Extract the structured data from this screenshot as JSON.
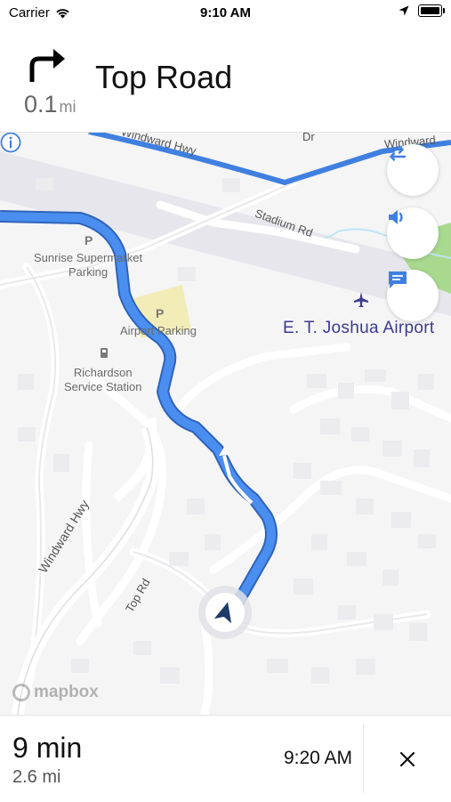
{
  "status_bar": {
    "carrier": "Carrier",
    "time": "9:10 AM"
  },
  "banner": {
    "distance_value": "0.1",
    "distance_unit": "mi",
    "street_name": "Top Road",
    "maneuver_icon": "turn-right-icon"
  },
  "map": {
    "labels": {
      "windward_hwy_top": "Windward Hwy",
      "windward_top_right": "Windward",
      "stadium_rd": "Stadium Rd",
      "dr_fragment": "Dr",
      "sunrise_parking": "Sunrise Supermarket\nParking",
      "airport_parking": "Airport Parking",
      "service_station": "Richardson\nService Station",
      "airport": "E. T. Joshua Airport",
      "windward_hwy_bottom": "Windward Hwy",
      "top_rd": "Top Rd",
      "parking_symbol": "P"
    },
    "buttons": {
      "overview": "route-overview-icon",
      "mute": "speaker-icon",
      "feedback": "feedback-icon"
    },
    "attribution": "mapbox",
    "colors": {
      "route": "#3f7fe0",
      "route_casing": "#2f63b8",
      "airport_label": "#3d3a8f",
      "park": "#a8d98e"
    }
  },
  "bottom_bar": {
    "duration": "9 min",
    "distance": "2.6 mi",
    "arrival_time": "9:20 AM"
  }
}
